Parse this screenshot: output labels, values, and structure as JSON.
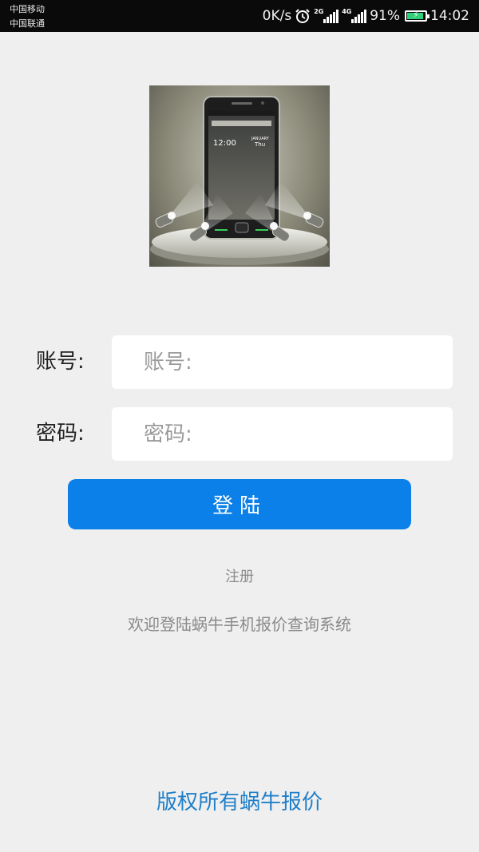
{
  "status_bar": {
    "carrier_1": "中国移动",
    "carrier_2": "中国联通",
    "net_speed": "0K/s",
    "signal_1_tag": "2G",
    "signal_2_tag": "4G",
    "battery_percent": "91%",
    "battery_level": 0.91,
    "time": "14:02"
  },
  "logo": {
    "icon": "phone-showcase-image",
    "screen_time": "12:00",
    "screen_month": "JANUARY",
    "screen_day": "Thu"
  },
  "form": {
    "account_label": "账号:",
    "account_placeholder": "账号:",
    "account_value": "",
    "password_label": "密码:",
    "password_placeholder": "密码:",
    "password_value": ""
  },
  "actions": {
    "login_label": "登陆",
    "register_label": "注册"
  },
  "welcome_text": "欢迎登陆蜗牛手机报价查询系统",
  "copyright_text": "版权所有蜗牛报价",
  "colors": {
    "background": "#efefef",
    "primary": "#0a80e8",
    "copyright": "#1f7fc8",
    "muted_text": "#8a8a8a"
  }
}
